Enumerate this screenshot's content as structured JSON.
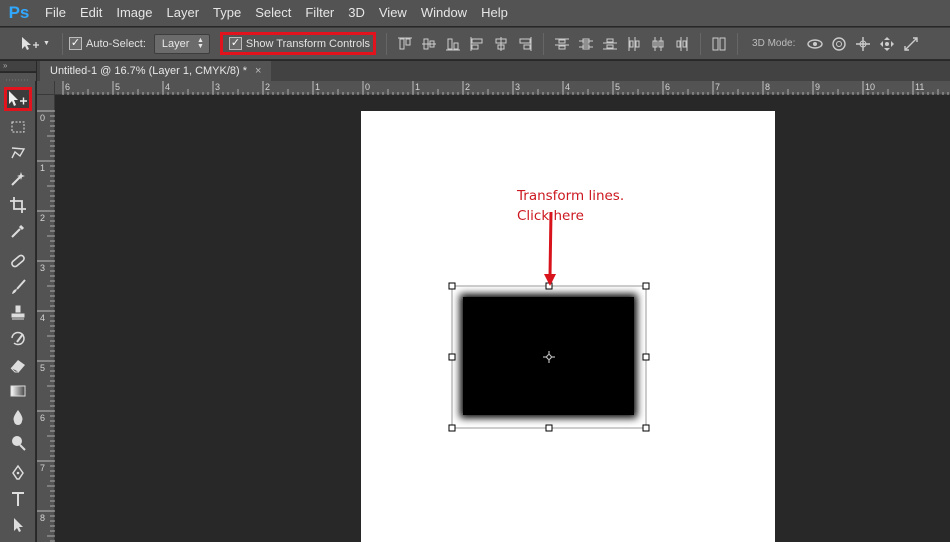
{
  "app": {
    "logo_text": "Ps"
  },
  "menu": [
    "File",
    "Edit",
    "Image",
    "Layer",
    "Type",
    "Select",
    "Filter",
    "3D",
    "View",
    "Window",
    "Help"
  ],
  "options": {
    "auto_select_label": "Auto-Select:",
    "auto_select_checked": true,
    "layer_select_value": "Layer",
    "show_transform_label": "Show Transform Controls",
    "show_transform_checked": true,
    "mode_label": "3D Mode:"
  },
  "document": {
    "tab_title": "Untitled-1 @ 16.7% (Layer 1, CMYK/8) *",
    "tab_close": "×"
  },
  "ruler": {
    "top_labels": [
      "6",
      "5",
      "4",
      "3",
      "2",
      "1",
      "0",
      "1",
      "2",
      "3",
      "4",
      "5",
      "6",
      "7",
      "8",
      "9",
      "10",
      "11"
    ],
    "left_labels": [
      "0",
      "1",
      "2",
      "3",
      "4",
      "5",
      "6",
      "7",
      "8"
    ]
  },
  "annotation": {
    "line1": "Transform lines.",
    "line2": "Click here",
    "color": "#cc1820"
  },
  "highlight_color": "#e3131e",
  "tools": [
    "move-tool-icon",
    "marquee-tool-icon",
    "lasso-tool-icon",
    "magic-wand-tool-icon",
    "crop-tool-icon",
    "eyedropper-tool-icon",
    "healing-brush-tool-icon",
    "brush-tool-icon",
    "clone-stamp-tool-icon",
    "history-brush-tool-icon",
    "eraser-tool-icon",
    "gradient-tool-icon",
    "blur-tool-icon",
    "dodge-tool-icon",
    "pen-tool-icon",
    "type-tool-icon",
    "path-selection-tool-icon"
  ]
}
